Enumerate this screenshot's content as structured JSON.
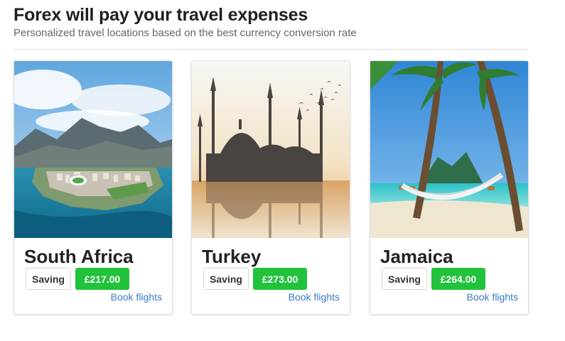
{
  "header": {
    "title": "Forex will pay your travel expenses",
    "subtitle": "Personalized travel locations based on the best currency conversion rate"
  },
  "destinations": [
    {
      "name": "South Africa",
      "saving_label": "Saving",
      "saving_value": "£217.00",
      "action": "Book flights"
    },
    {
      "name": "Turkey",
      "saving_label": "Saving",
      "saving_value": "£273.00",
      "action": "Book flights"
    },
    {
      "name": "Jamaica",
      "saving_label": "Saving",
      "saving_value": "£264.00",
      "action": "Book flights"
    }
  ],
  "colors": {
    "saving_badge": "#21c23c",
    "link": "#3a7bc8"
  }
}
